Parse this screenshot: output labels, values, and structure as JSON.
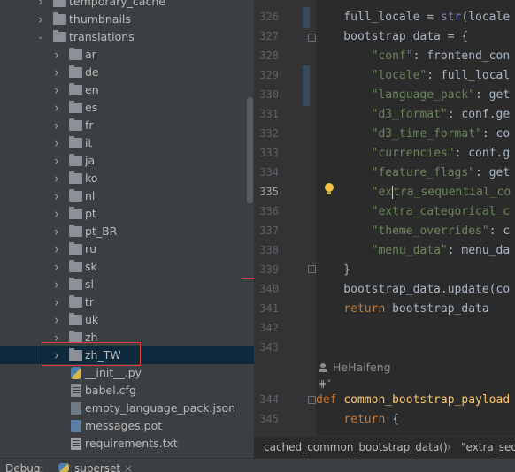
{
  "project_tree": {
    "items": [
      {
        "label": "temporary_cache",
        "type": "folder",
        "expanded": false
      },
      {
        "label": "thumbnails",
        "type": "folder",
        "expanded": false
      },
      {
        "label": "translations",
        "type": "folder",
        "expanded": true
      },
      {
        "label": "ar",
        "type": "folder",
        "expanded": false
      },
      {
        "label": "de",
        "type": "folder",
        "expanded": false
      },
      {
        "label": "en",
        "type": "folder",
        "expanded": false
      },
      {
        "label": "es",
        "type": "folder",
        "expanded": false
      },
      {
        "label": "fr",
        "type": "folder",
        "expanded": false
      },
      {
        "label": "it",
        "type": "folder",
        "expanded": false
      },
      {
        "label": "ja",
        "type": "folder",
        "expanded": false
      },
      {
        "label": "ko",
        "type": "folder",
        "expanded": false
      },
      {
        "label": "nl",
        "type": "folder",
        "expanded": false
      },
      {
        "label": "pt",
        "type": "folder",
        "expanded": false
      },
      {
        "label": "pt_BR",
        "type": "folder",
        "expanded": false
      },
      {
        "label": "ru",
        "type": "folder",
        "expanded": false
      },
      {
        "label": "sk",
        "type": "folder",
        "expanded": false
      },
      {
        "label": "sl",
        "type": "folder",
        "expanded": false
      },
      {
        "label": "tr",
        "type": "folder",
        "expanded": false
      },
      {
        "label": "uk",
        "type": "folder",
        "expanded": false
      },
      {
        "label": "zh",
        "type": "folder",
        "expanded": false
      },
      {
        "label": "zh_TW",
        "type": "folder",
        "expanded": false,
        "selected": true
      },
      {
        "label": "__init__.py",
        "type": "python-file-icon"
      },
      {
        "label": "babel.cfg",
        "type": "config-file-icon"
      },
      {
        "label": "empty_language_pack.json",
        "type": "json-file-icon"
      },
      {
        "label": "messages.pot",
        "type": "pot-file-icon"
      },
      {
        "label": "requirements.txt",
        "type": "text-file-icon"
      }
    ]
  },
  "editor": {
    "line_numbers": [
      "326",
      "327",
      "328",
      "329",
      "330",
      "331",
      "332",
      "333",
      "334",
      "335",
      "336",
      "337",
      "338",
      "339",
      "340",
      "341",
      "342",
      "343",
      "344",
      "345"
    ],
    "current_line": "335",
    "lines": [
      [
        {
          "t": "    full_locale = ",
          "c": ""
        },
        {
          "t": "str",
          "c": "bi"
        },
        {
          "t": "(locale",
          "c": ""
        }
      ],
      [
        {
          "t": "    bootstrap_data = {",
          "c": ""
        }
      ],
      [
        {
          "t": "        ",
          "c": ""
        },
        {
          "t": "\"conf\"",
          "c": "st"
        },
        {
          "t": ": frontend_con",
          "c": ""
        }
      ],
      [
        {
          "t": "        ",
          "c": ""
        },
        {
          "t": "\"locale\"",
          "c": "st"
        },
        {
          "t": ": full_local",
          "c": ""
        }
      ],
      [
        {
          "t": "        ",
          "c": ""
        },
        {
          "t": "\"language_pack\"",
          "c": "st"
        },
        {
          "t": ": get",
          "c": ""
        }
      ],
      [
        {
          "t": "        ",
          "c": ""
        },
        {
          "t": "\"d3_format\"",
          "c": "st"
        },
        {
          "t": ": conf.ge",
          "c": ""
        }
      ],
      [
        {
          "t": "        ",
          "c": ""
        },
        {
          "t": "\"d3_time_format\"",
          "c": "st"
        },
        {
          "t": ": co",
          "c": ""
        }
      ],
      [
        {
          "t": "        ",
          "c": ""
        },
        {
          "t": "\"currencies\"",
          "c": "st"
        },
        {
          "t": ": conf.g",
          "c": ""
        }
      ],
      [
        {
          "t": "        ",
          "c": ""
        },
        {
          "t": "\"feature_flags\"",
          "c": "st"
        },
        {
          "t": ": get",
          "c": ""
        }
      ],
      [
        {
          "t": "        ",
          "c": ""
        },
        {
          "t": "\"ex",
          "c": "st"
        },
        {
          "t": "tra_sequential_co",
          "c": "st"
        }
      ],
      [
        {
          "t": "        ",
          "c": ""
        },
        {
          "t": "\"extra_categorical_c",
          "c": "st"
        }
      ],
      [
        {
          "t": "        ",
          "c": ""
        },
        {
          "t": "\"theme_overrides\"",
          "c": "st"
        },
        {
          "t": ": c",
          "c": ""
        }
      ],
      [
        {
          "t": "        ",
          "c": ""
        },
        {
          "t": "\"menu_data\"",
          "c": "st"
        },
        {
          "t": ": menu_da",
          "c": ""
        }
      ],
      [
        {
          "t": "    }",
          "c": ""
        }
      ],
      [
        {
          "t": "    bootstrap_data.update(co",
          "c": ""
        }
      ],
      [
        {
          "t": "    ",
          "c": ""
        },
        {
          "t": "return",
          "c": "kw"
        },
        {
          "t": " bootstrap_data",
          "c": ""
        }
      ],
      [
        {
          "t": "",
          "c": ""
        }
      ],
      [
        {
          "t": "",
          "c": ""
        }
      ],
      [
        {
          "t": "def ",
          "c": "kw"
        },
        {
          "t": "common_bootstrap_payload",
          "c": "fn"
        }
      ],
      [
        {
          "t": "    ",
          "c": ""
        },
        {
          "t": "return",
          "c": "kw"
        },
        {
          "t": " {",
          "c": ""
        }
      ]
    ],
    "author_hint": "HeHaifeng"
  },
  "breadcrumb": {
    "items": [
      "cached_common_bootstrap_data()",
      "\"extra_seq"
    ]
  },
  "debug_bar": {
    "label": "Debug:",
    "config_name": "superset"
  }
}
